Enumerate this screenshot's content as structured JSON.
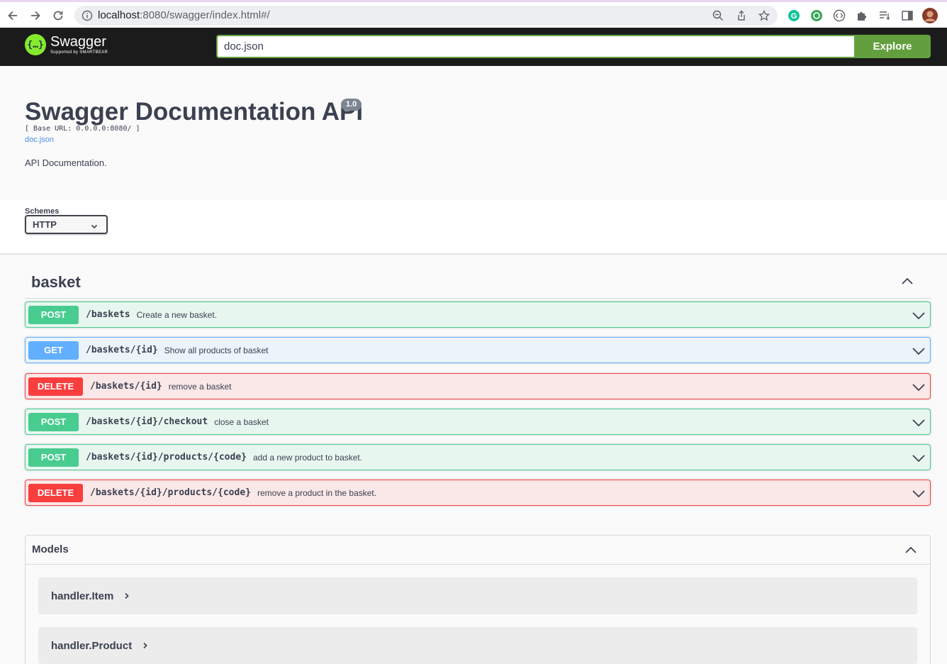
{
  "browser": {
    "url_host": "localhost",
    "url_rest": ":8080/swagger/index.html#/",
    "toolbar_icons": [
      "zoom-icon",
      "share-icon",
      "bookmark-star-icon",
      "grammarly-icon",
      "extension-green-icon",
      "extension-code-icon",
      "extensions-puzzle-icon",
      "reading-list-icon",
      "side-panel-icon",
      "profile-avatar"
    ]
  },
  "topbar": {
    "logo_title": "Swagger",
    "logo_sub": "Supported by SMARTBEAR",
    "spec_url": "doc.json",
    "explore_label": "Explore"
  },
  "info": {
    "title": "Swagger Documentation API",
    "version": "1.0",
    "base_url": "[ Base URL: 0.0.0.0:8080/ ]",
    "doc_link": "doc.json",
    "description": "API Documentation."
  },
  "schemes": {
    "label": "Schemes",
    "selected": "HTTP"
  },
  "tag": {
    "name": "basket",
    "operations": [
      {
        "method": "POST",
        "path": "/baskets",
        "summary": "Create a new basket."
      },
      {
        "method": "GET",
        "path": "/baskets/{id}",
        "summary": "Show all products of basket"
      },
      {
        "method": "DELETE",
        "path": "/baskets/{id}",
        "summary": "remove a basket"
      },
      {
        "method": "POST",
        "path": "/baskets/{id}/checkout",
        "summary": "close a basket"
      },
      {
        "method": "POST",
        "path": "/baskets/{id}/products/{code}",
        "summary": "add a new product to basket."
      },
      {
        "method": "DELETE",
        "path": "/baskets/{id}/products/{code}",
        "summary": "remove a product in the basket."
      }
    ]
  },
  "models": {
    "title": "Models",
    "items": [
      {
        "name": "handler.Item"
      },
      {
        "name": "handler.Product"
      }
    ]
  },
  "colors": {
    "post": "#49cc90",
    "get": "#61affe",
    "delete": "#f93e3e",
    "explore": "#62a03f",
    "topbar": "#1b1b1b"
  }
}
